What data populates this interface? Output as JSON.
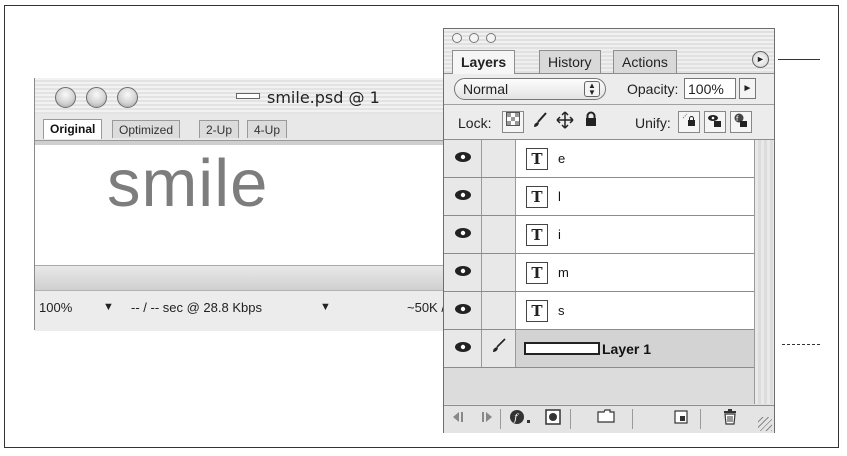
{
  "document_window": {
    "title": "smile.psd @ 1",
    "tabs": [
      "Original",
      "Optimized",
      "2-Up",
      "4-Up"
    ],
    "canvas_text": "smile",
    "status": {
      "zoom": "100%",
      "speed": "-- / -- sec @ 28.8 Kbps",
      "size": "~50K /"
    },
    "arrow": "▼"
  },
  "layers_palette": {
    "tabs": [
      "Layers",
      "History",
      "Actions"
    ],
    "menu_icon": "►",
    "blend_mode": "Normal",
    "opacity_label": "Opacity:",
    "opacity_value": "100%",
    "opacity_arrow": "►",
    "lock_label": "Lock:",
    "unify_label": "Unify:",
    "layers": [
      {
        "name": "e",
        "type": "text",
        "thumb": "T"
      },
      {
        "name": "l",
        "type": "text",
        "thumb": "T"
      },
      {
        "name": "i",
        "type": "text",
        "thumb": "T"
      },
      {
        "name": "m",
        "type": "text",
        "thumb": "T"
      },
      {
        "name": "s",
        "type": "text",
        "thumb": "T"
      },
      {
        "name": "Layer 1",
        "type": "raster",
        "selected": true
      }
    ]
  }
}
